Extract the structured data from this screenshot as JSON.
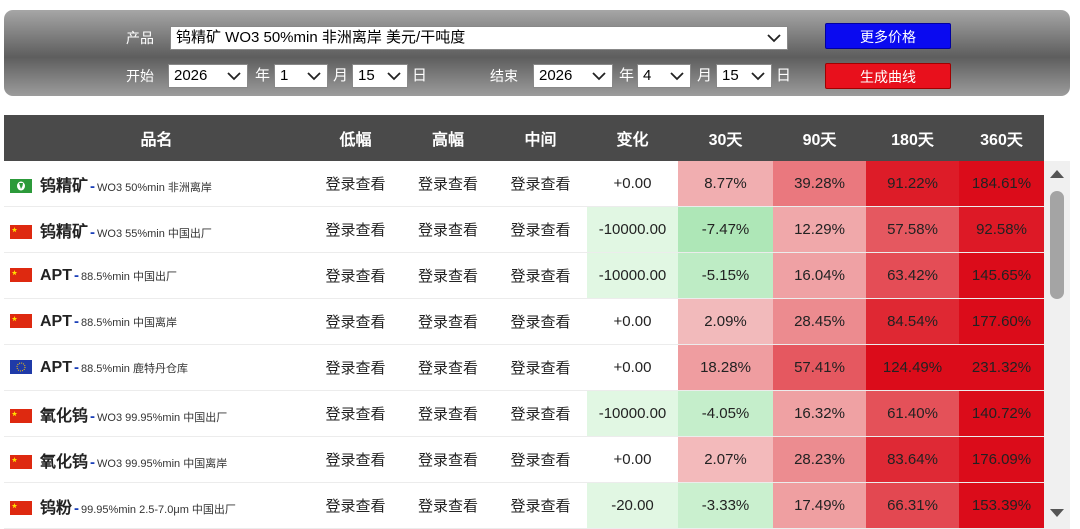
{
  "controls": {
    "product_label": "产品",
    "product_value": "钨精矿 WO3 50%min 非洲离岸 美元/干吨度",
    "start_label": "开始",
    "end_label": "结束",
    "start_year": "2026",
    "start_month": "1",
    "start_day": "15",
    "end_year": "2026",
    "end_month": "4",
    "end_day": "15",
    "year_unit": "年",
    "month_unit": "月",
    "day_unit": "日",
    "more_prices": "更多价格",
    "generate_curve": "生成曲线"
  },
  "table": {
    "headers": [
      "品名",
      "低幅",
      "高幅",
      "中间",
      "变化",
      "30天",
      "90天",
      "180天",
      "360天"
    ],
    "rows": [
      {
        "flag": "africa",
        "name": "钨精矿",
        "spec": "WO3 50%min 非洲离岸",
        "low": "登录查看",
        "high": "登录查看",
        "mid": "登录查看",
        "change": "+0.00",
        "d30": "8.77%",
        "d90": "39.28%",
        "d180": "91.22%",
        "d360": "184.61%"
      },
      {
        "flag": "china",
        "name": "钨精矿",
        "spec": "WO3 55%min 中国出厂",
        "low": "登录查看",
        "high": "登录查看",
        "mid": "登录查看",
        "change": "-10000.00",
        "d30": "-7.47%",
        "d90": "12.29%",
        "d180": "57.58%",
        "d360": "92.58%"
      },
      {
        "flag": "china",
        "name": "APT",
        "spec": "88.5%min 中国出厂",
        "low": "登录查看",
        "high": "登录查看",
        "mid": "登录查看",
        "change": "-10000.00",
        "d30": "-5.15%",
        "d90": "16.04%",
        "d180": "63.42%",
        "d360": "145.65%"
      },
      {
        "flag": "china",
        "name": "APT",
        "spec": "88.5%min 中国离岸",
        "low": "登录查看",
        "high": "登录查看",
        "mid": "登录查看",
        "change": "+0.00",
        "d30": "2.09%",
        "d90": "28.45%",
        "d180": "84.54%",
        "d360": "177.60%"
      },
      {
        "flag": "eu",
        "name": "APT",
        "spec": "88.5%min 鹿特丹仓库",
        "low": "登录查看",
        "high": "登录查看",
        "mid": "登录查看",
        "change": "+0.00",
        "d30": "18.28%",
        "d90": "57.41%",
        "d180": "124.49%",
        "d360": "231.32%"
      },
      {
        "flag": "china",
        "name": "氧化钨",
        "spec": "WO3 99.95%min 中国出厂",
        "low": "登录查看",
        "high": "登录查看",
        "mid": "登录查看",
        "change": "-10000.00",
        "d30": "-4.05%",
        "d90": "16.32%",
        "d180": "61.40%",
        "d360": "140.72%"
      },
      {
        "flag": "china",
        "name": "氧化钨",
        "spec": "WO3 99.95%min 中国离岸",
        "low": "登录查看",
        "high": "登录查看",
        "mid": "登录查看",
        "change": "+0.00",
        "d30": "2.07%",
        "d90": "28.23%",
        "d180": "83.64%",
        "d360": "176.09%"
      },
      {
        "flag": "china",
        "name": "钨粉",
        "spec": "99.95%min 2.5-7.0μm 中国出厂",
        "low": "登录查看",
        "high": "登录查看",
        "mid": "登录查看",
        "change": "-20.00",
        "d30": "-3.33%",
        "d90": "17.49%",
        "d180": "66.31%",
        "d360": "153.39%"
      }
    ]
  }
}
